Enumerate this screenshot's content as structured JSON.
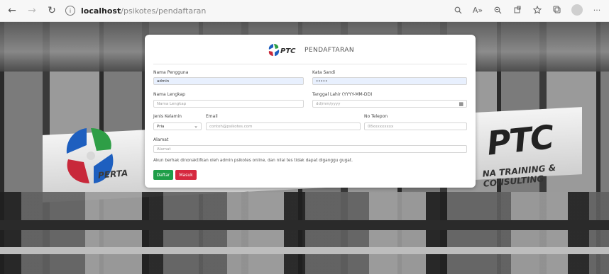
{
  "browser": {
    "url_host": "localhost",
    "url_path": "/psikotes/pendaftaran",
    "back_glyph": "←",
    "forward_glyph": "→",
    "reload_glyph": "↻",
    "info_glyph": "i",
    "read_aloud_glyph": "A»",
    "more_glyph": "···"
  },
  "background": {
    "sign_left_text": "PERTA",
    "sign_right_text": "NA TRAINING & CONSULTING",
    "ptc_text": "PTC"
  },
  "header": {
    "brand": "PTC",
    "title": "PENDAFTARAN"
  },
  "form": {
    "username": {
      "label": "Nama Pengguna",
      "value": "admin"
    },
    "password": {
      "label": "Kata Sandi",
      "value": "•••••"
    },
    "fullname": {
      "label": "Nama Lengkap",
      "placeholder": "Nama Lengkap"
    },
    "birthdate": {
      "label": "Tanggal Lahir (YYYY-MM-DD)",
      "placeholder": "dd/mm/yyyy",
      "calendar_glyph": "▦"
    },
    "gender": {
      "label": "Jenis Kelamin",
      "value": "Pria",
      "chevron": "⌄"
    },
    "email": {
      "label": "Email",
      "placeholder": "contoh@psikotes.com"
    },
    "phone": {
      "label": "No Telepon",
      "placeholder": "08xxxxxxxxx"
    },
    "address": {
      "label": "Alamat",
      "placeholder": "Alamat"
    },
    "note": "Akun berhak dinonaktifkan oleh admin psikotes online, dan nilai tes tidak dapat diganggu gugat."
  },
  "buttons": {
    "register": "Daftar",
    "login": "Masuk"
  },
  "colors": {
    "register": "#1e9e48",
    "login": "#d6283f"
  }
}
